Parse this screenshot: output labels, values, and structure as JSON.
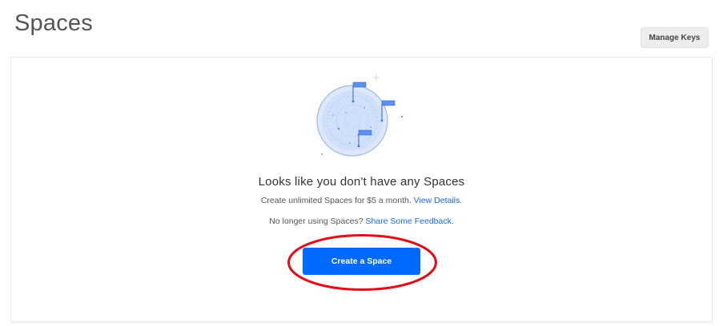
{
  "header": {
    "title": "Spaces",
    "manage_keys_label": "Manage Keys"
  },
  "empty_state": {
    "illustration_icon": "spaces-globe-with-flags-illustration",
    "heading": "Looks like you don't have any Spaces",
    "pricing_text": "Create unlimited Spaces for $5 a month.",
    "view_details_link": "View Details.",
    "feedback_text": "No longer using Spaces?",
    "feedback_link": "Share Some Feedback.",
    "create_button_label": "Create a Space"
  },
  "annotation": {
    "highlight_color": "#e30b17",
    "highlight_shape": "ellipse-around-create-button"
  },
  "colors": {
    "primary_button": "#0069ff",
    "link": "#1f68e0",
    "secondary_button": "#ededed"
  }
}
